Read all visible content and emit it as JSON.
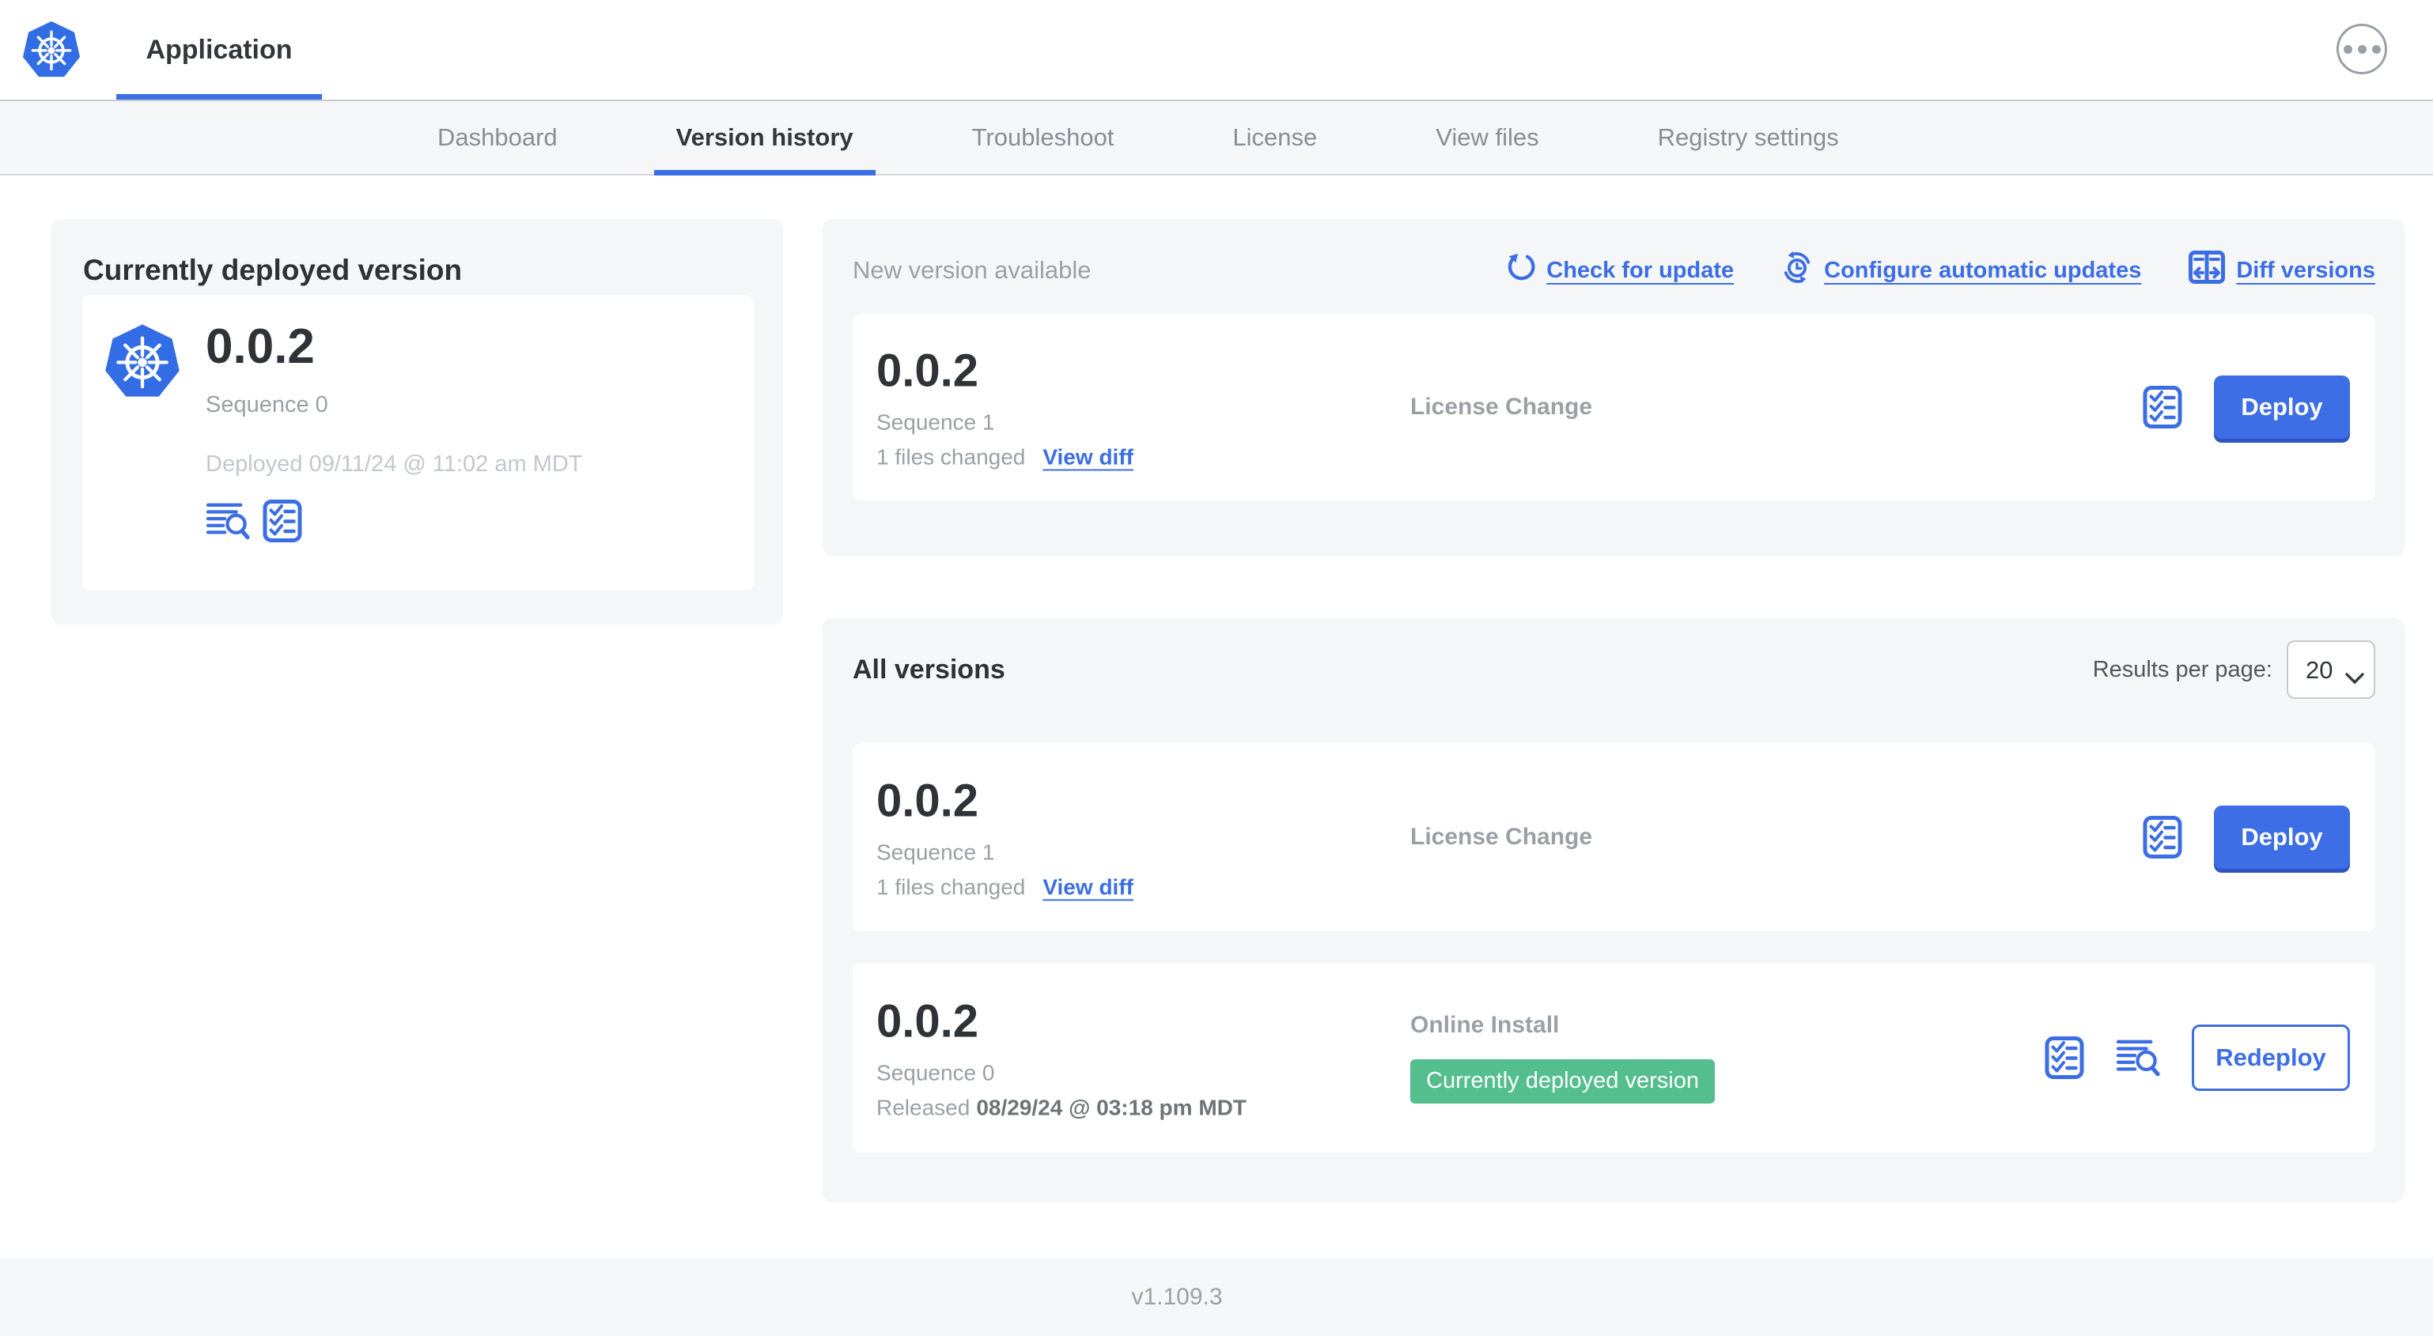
{
  "colors": {
    "accent_blue": "#3b6de4",
    "k8s_logo_blue": "#326de6",
    "badge_green": "#54be8e",
    "section_bg": "#f5f6f8",
    "muted_text": "#9ba0a6"
  },
  "icons": {
    "app_logo": "kubernetes-wheel",
    "menu": "ellipsis-circle",
    "check_for_update": "refresh-arrow",
    "configure_updates": "clock-sync",
    "diff_versions": "split-diff",
    "release_notes": "checklist",
    "logs": "lines-magnifier",
    "select": "chevron-down"
  },
  "header": {
    "app_tab_label": "Application"
  },
  "nav": {
    "tabs": [
      {
        "label": "Dashboard"
      },
      {
        "label": "Version history"
      },
      {
        "label": "Troubleshoot"
      },
      {
        "label": "License"
      },
      {
        "label": "View files"
      },
      {
        "label": "Registry settings"
      }
    ],
    "active_tab": "Version history"
  },
  "current_version": {
    "title": "Currently deployed version",
    "version": "0.0.2",
    "sequence": "Sequence 0",
    "deployed_timestamp": "Deployed 09/11/24 @ 11:02 am MDT"
  },
  "new_version": {
    "title": "New version available",
    "check_for_update_label": "Check for update",
    "configure_updates_label": "Configure automatic updates",
    "diff_versions_label": "Diff versions",
    "card": {
      "version": "0.0.2",
      "sequence": "Sequence 1",
      "files_changed": "1 files changed",
      "view_diff_label": "View diff",
      "source": "License Change",
      "deploy_label": "Deploy"
    }
  },
  "all_versions": {
    "title": "All versions",
    "results_per_page_label": "Results per page:",
    "results_per_page_value": "20",
    "rows": [
      {
        "version": "0.0.2",
        "sequence": "Sequence 1",
        "files_changed": "1 files changed",
        "view_diff_label": "View diff",
        "source": "License Change",
        "action_label": "Deploy"
      },
      {
        "version": "0.0.2",
        "sequence": "Sequence 0",
        "released_prefix": "Released",
        "released_date": "08/29/24 @ 03:18 pm MDT",
        "source": "Online Install",
        "badge": "Currently deployed version",
        "action_label": "Redeploy"
      }
    ]
  },
  "footer": {
    "app_version": "v1.109.3"
  }
}
